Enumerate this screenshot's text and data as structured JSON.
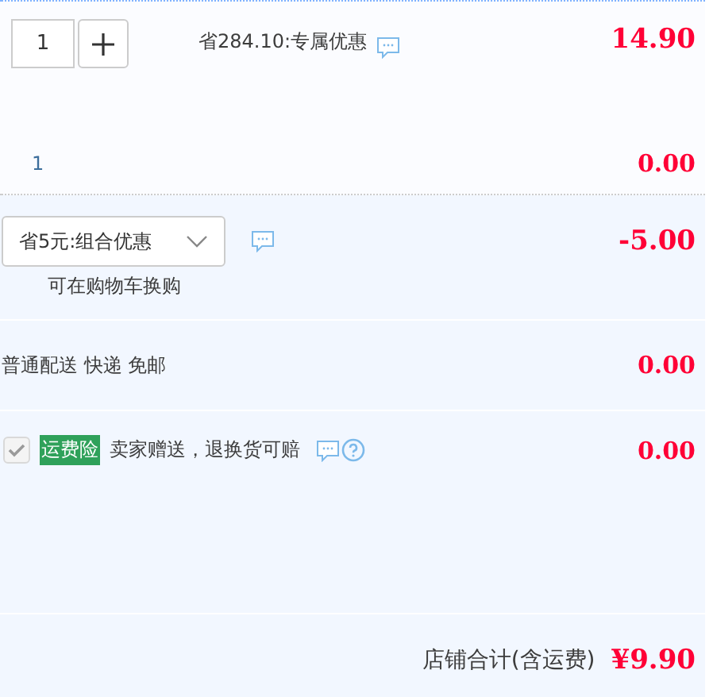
{
  "item": {
    "quantity": "1",
    "promo": "省284.10:专属优惠",
    "price": "14.90",
    "count": "1",
    "subtotal": "0.00"
  },
  "bundle": {
    "selected_option": "省5元:组合优惠",
    "note": "可在购物车换购",
    "amount": "-5.00"
  },
  "shipping": {
    "label": "普通配送 快递 免邮",
    "amount": "0.00"
  },
  "insurance": {
    "checked": true,
    "disabled": true,
    "badge": "运费险",
    "text": "卖家赠送，退换货可赔",
    "amount": "0.00"
  },
  "total": {
    "label": "店铺合计(含运费)",
    "amount": "¥9.90"
  }
}
